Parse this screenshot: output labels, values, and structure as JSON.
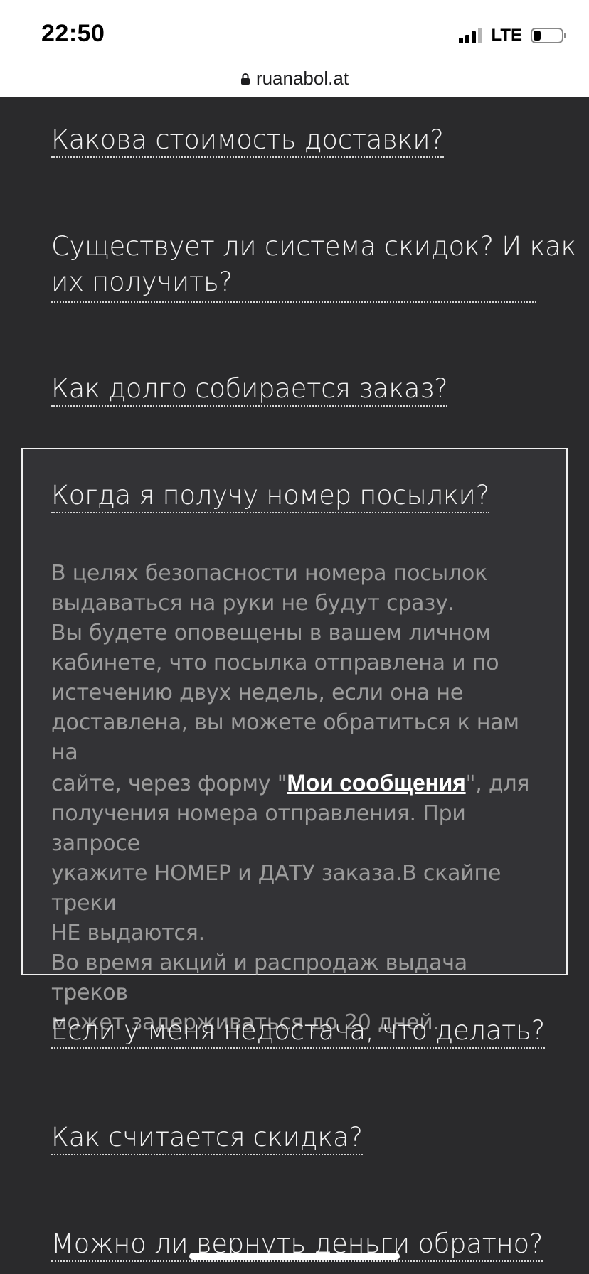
{
  "status_bar": {
    "time": "22:50",
    "network": "LTE"
  },
  "browser": {
    "url": "ruanabol.at"
  },
  "faq": {
    "q1": "Какова стоимость доставки?",
    "q2_line1": "Существует ли система скидок? И как",
    "q2_line2": "их получить?",
    "q3": "Как долго собирается заказ?",
    "q4": "Когда я получу номер посылки?",
    "q4_answer": {
      "p1_line1": "В целях безопасности номера посылок",
      "p1_line2": "выдаваться на руки не будут сразу.",
      "p2_line1": "Вы будете оповещены в вашем личном",
      "p2_line2": "кабинете, что посылка отправлена и по",
      "p2_line3": "истечению двух недель, если она не",
      "p2_line4": "доставлена, вы можете обратиться к нам на",
      "p2_line5_before": "сайте, через форму \"",
      "p2_link": "Мои сообщения",
      "p2_line5_after": "\", для",
      "p2_line6": "получения номера отправления. При запросе",
      "p2_line7": "укажите НОМЕР и ДАТУ заказа.В скайпе треки",
      "p2_line8": "НЕ выдаются.",
      "p3_line1": "Во время акций и распродаж выдача треков",
      "p3_line2": "может задерживаться до 20 дней."
    },
    "q5": "Если у меня недостача, что делать?",
    "q6": "Как считается скидка?",
    "q7": "Можно ли вернуть деньги обратно?"
  }
}
